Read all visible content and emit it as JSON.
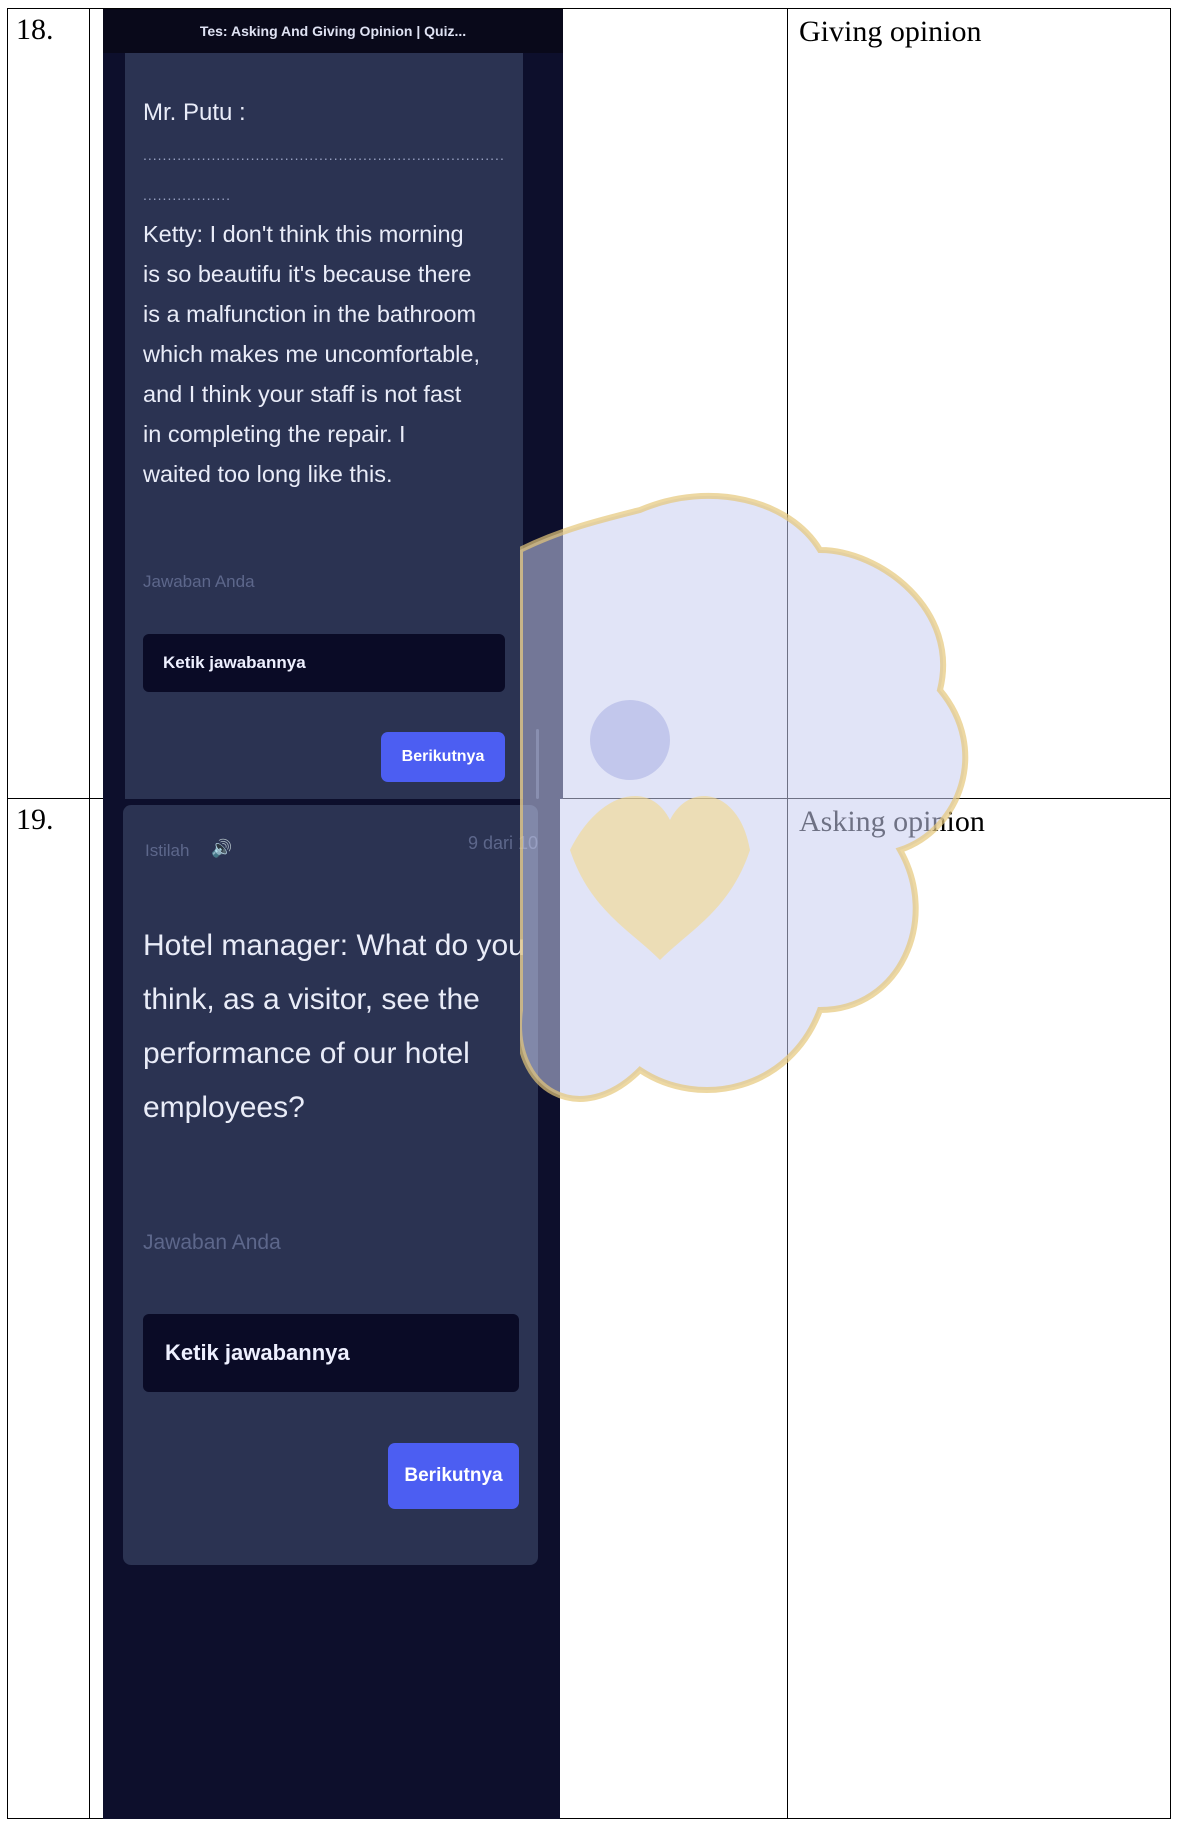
{
  "rows": [
    {
      "number": "18.",
      "answer": "Giving opinion",
      "screen": {
        "title_bar": "Tes: Asking And Giving Opinion | Quiz...",
        "speaker": "Mr. Putu :",
        "dots_line_1": "..........................................................................................",
        "dots_line_2": "..................",
        "question_lines": [
          "Ketty: I don't think this morning",
          "is so beautifu it's because there",
          "is a malfunction in the bathroom",
          "which makes me uncomfortable,",
          "and I think your staff is not fast",
          "in completing the repair. I",
          "waited too long like this."
        ],
        "answer_label": "Jawaban Anda",
        "input_placeholder": "Ketik jawabannya",
        "next_button": "Berikutnya"
      }
    },
    {
      "number": "19.",
      "answer": "Asking opinion",
      "screen": {
        "term_label": "Istilah",
        "progress": "9 dari 10",
        "question_lines": [
          "Hotel manager: What do you",
          "think, as a visitor, see the",
          "performance of our hotel",
          "employees?"
        ],
        "answer_label": "Jawaban Anda",
        "input_placeholder": "Ketik jawabannya",
        "next_button": "Berikutnya"
      }
    }
  ]
}
